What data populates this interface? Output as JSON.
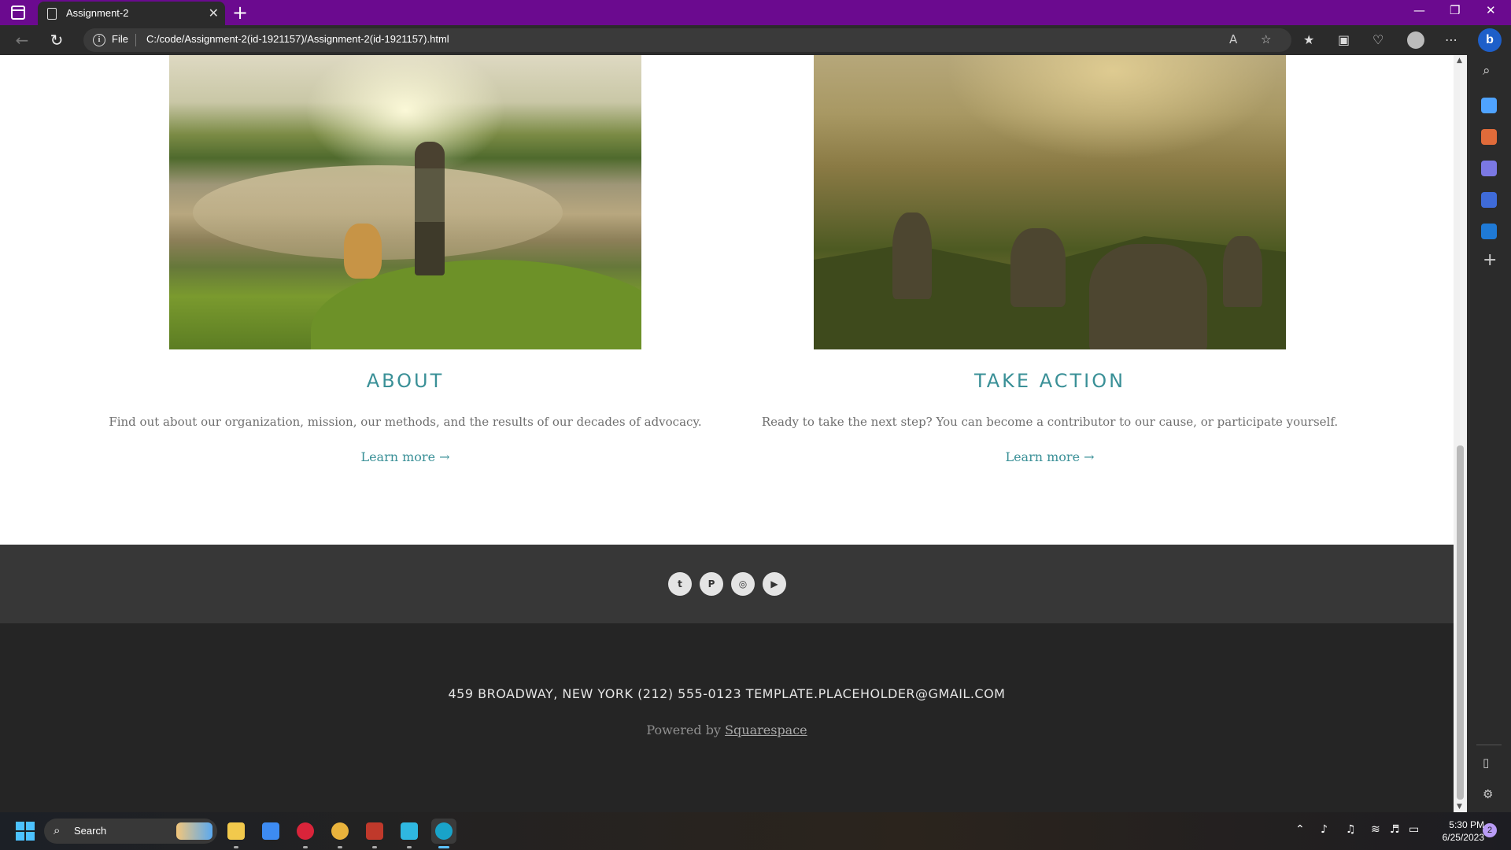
{
  "browser": {
    "tab_title": "Assignment-2",
    "tab_close": "✕",
    "new_tab": "+",
    "address_scheme": "File",
    "url": "C:/code/Assignment-2(id-1921157)/Assignment-2(id-1921157).html",
    "window_controls": {
      "minimize": "—",
      "restore": "❐",
      "close": "✕"
    }
  },
  "sidebar": {
    "colors": [
      "#4fa3ff",
      "#4fa3ff",
      "#e06b3a",
      "#7b78e3",
      "#3f6bd8",
      "#1f7ad6"
    ],
    "add_label": "+"
  },
  "page": {
    "columns": [
      {
        "title": "ABOUT",
        "description": "Find out about our organization, mission, our methods, and the results of our decades of advocacy.",
        "link": "Learn more →"
      },
      {
        "title": "TAKE ACTION",
        "description": "Ready to take the next step? You can become a contributor to our cause, or participate yourself.",
        "link": "Learn more →"
      }
    ],
    "social": {
      "icons": [
        "twitter-icon",
        "pinterest-icon",
        "instagram-icon",
        "youtube-icon"
      ],
      "glyphs": [
        "t",
        "P",
        "◎",
        "▶"
      ]
    },
    "footer": {
      "contact": "459 BROADWAY, NEW YORK (212) 555-0123 TEMPLATE.PLACEHOLDER@GMAIL.COM",
      "powered_prefix": "Powered by",
      "powered_link": "Squarespace"
    },
    "accent_color": "#3a9097"
  },
  "taskbar": {
    "search_placeholder": "Search",
    "time": "5:30 PM",
    "date": "6/25/2023",
    "notification_count": "2"
  }
}
